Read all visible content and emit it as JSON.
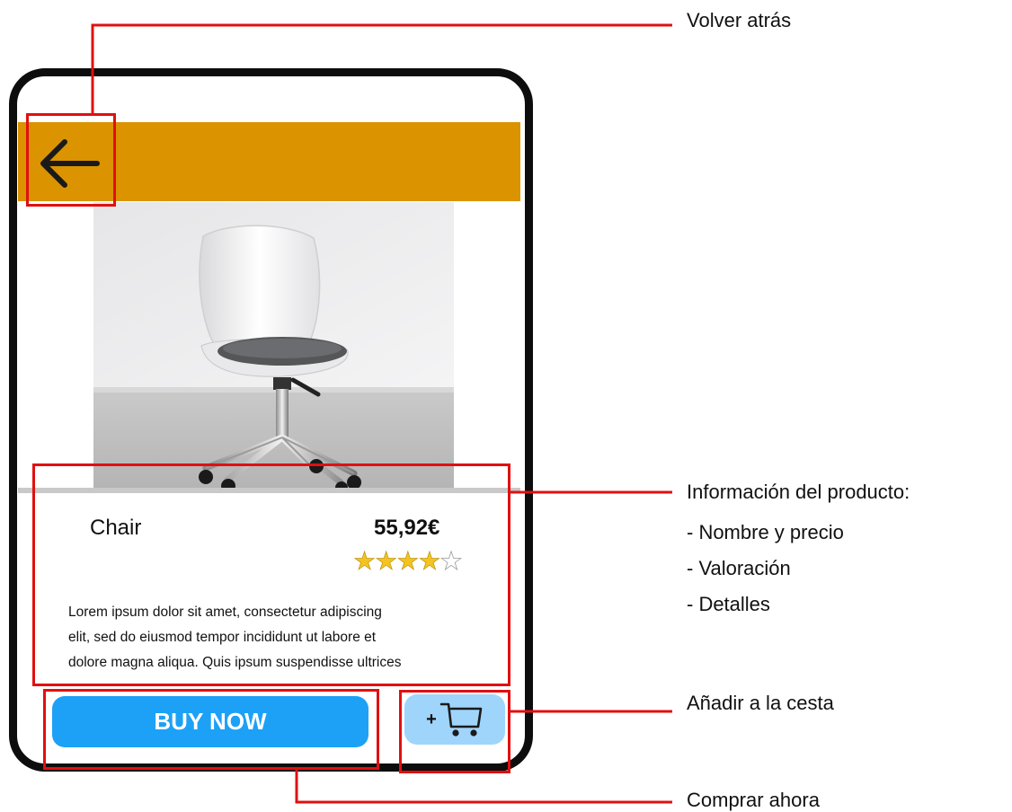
{
  "header": {
    "back_icon": "arrow-left-icon",
    "bar_color": "#db9300"
  },
  "product": {
    "name": "Chair",
    "price": "55,92€",
    "rating": 4,
    "rating_max": 5,
    "description_lines": [
      "Lorem ipsum dolor sit amet, consectetur adipiscing",
      "elit, sed do eiusmod tempor incididunt ut labore et",
      "dolore magna aliqua. Quis ipsum suspendisse ultrices"
    ]
  },
  "actions": {
    "buy_label": "BUY NOW",
    "buy_color": "#1da1f7",
    "cart_plus": "+",
    "cart_icon": "cart-icon",
    "cart_color": "#9fd5fb"
  },
  "annotations": {
    "back": "Volver atrás",
    "info_title": "Información del producto:",
    "info_items": [
      "- Nombre y precio",
      "- Valoración",
      "- Detalles"
    ],
    "add_to_cart": "Añadir a la cesta",
    "buy_now": "Comprar ahora",
    "highlight_color": "#e01010"
  }
}
